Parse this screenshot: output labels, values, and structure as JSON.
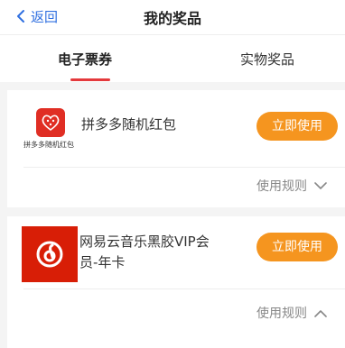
{
  "header": {
    "back_label": "返回",
    "title": "我的奖品"
  },
  "tabs": [
    {
      "label": "电子票券",
      "active": true
    },
    {
      "label": "实物奖品",
      "active": false
    }
  ],
  "prizes": [
    {
      "logo_caption": "拼多多随机红包",
      "name": "拼多多随机红包",
      "use_label": "立即使用",
      "rules_label": "使用规则",
      "rules_expanded": false,
      "icon": "pinduoduo-logo-icon"
    },
    {
      "name": "网易云音乐黑胶VIP会员-年卡",
      "use_label": "立即使用",
      "rules_label": "使用规则",
      "rules_expanded": true,
      "icon": "netease-music-logo-icon"
    }
  ],
  "colors": {
    "accent_blue": "#2f6fe0",
    "tab_underline_red": "#e4393c",
    "button_orange": "#f5951f",
    "pdd_red": "#e02e24",
    "netease_red": "#d81e06"
  }
}
